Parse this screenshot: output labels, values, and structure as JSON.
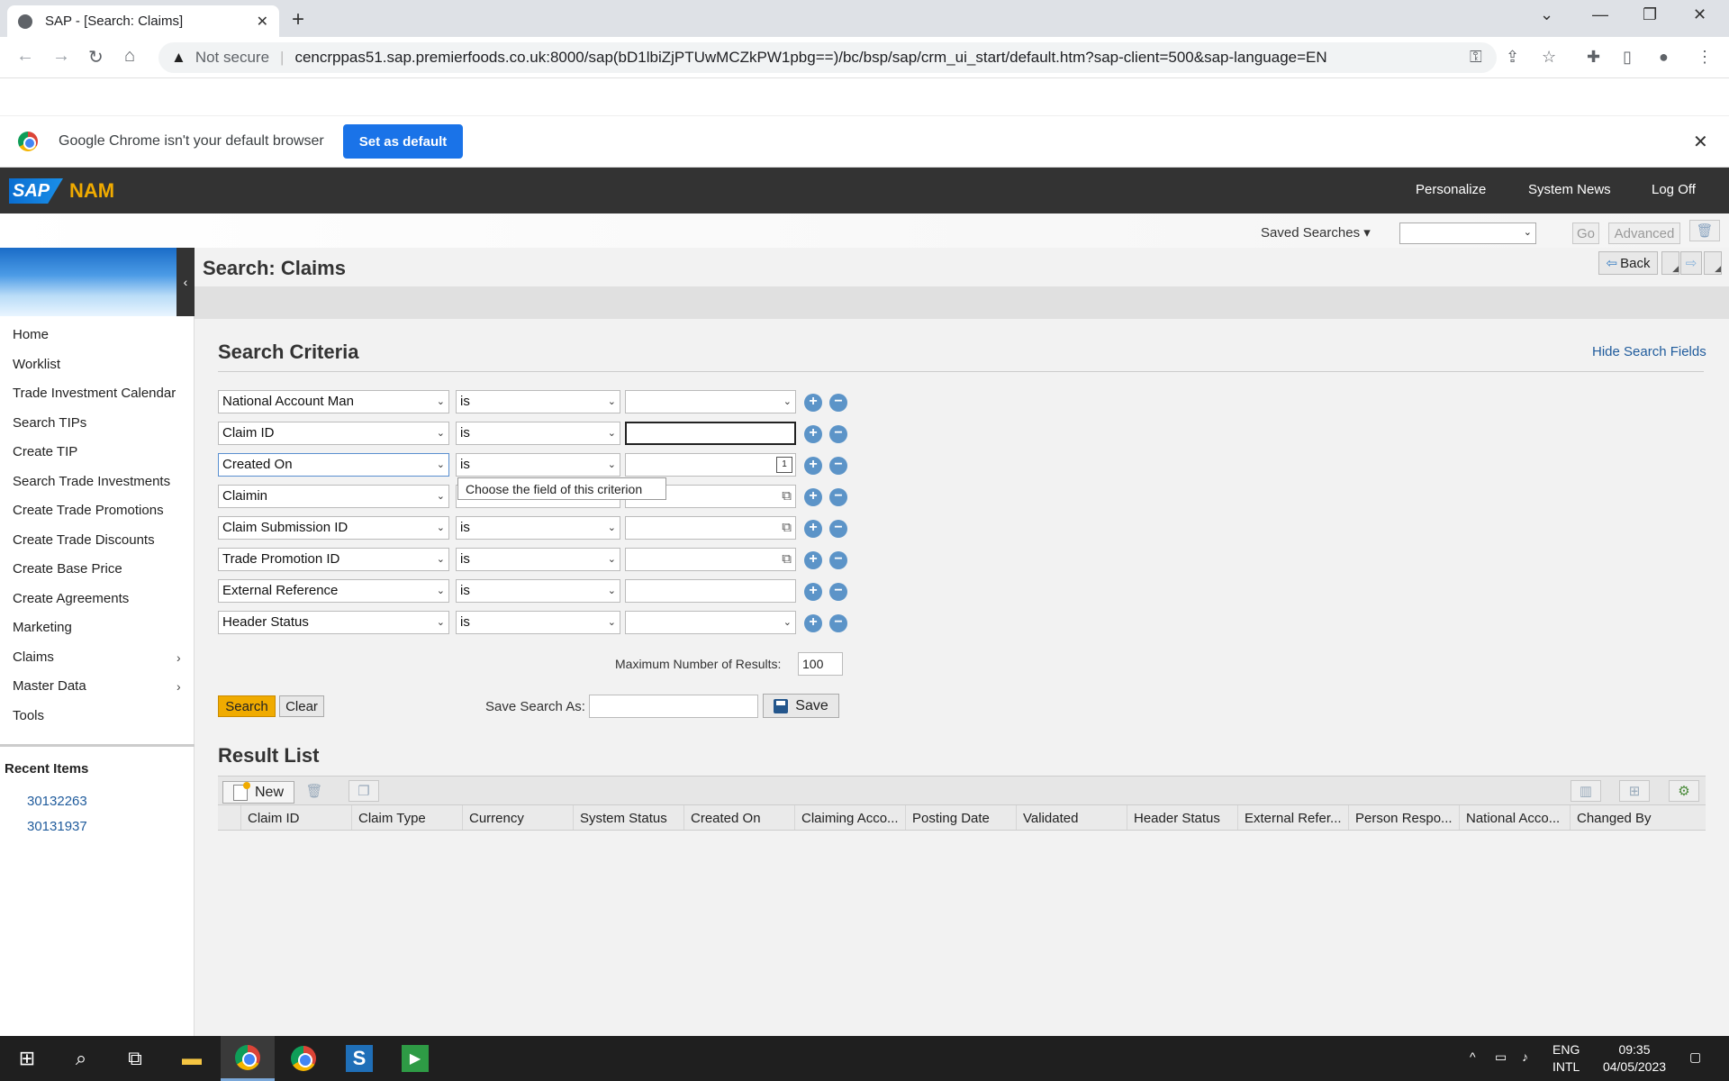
{
  "browser": {
    "tab_title": "SAP - [Search: Claims]",
    "not_secure": "Not secure",
    "url": "cencrppas51.sap.premierfoods.co.uk:8000/sap(bD1lbiZjPTUwMCZkPW1pbg==)/bc/bsp/sap/crm_ui_start/default.htm?sap-client=500&sap-language=EN",
    "infobar_message": "Google Chrome isn't your default browser",
    "set_default_label": "Set as default"
  },
  "sap_header": {
    "logo": "SAP",
    "app_name": "NAM",
    "links": [
      "Personalize",
      "System News",
      "Log Off"
    ]
  },
  "saved_searches": {
    "label": "Saved Searches",
    "selected": "",
    "go_label": "Go",
    "advanced_label": "Advanced"
  },
  "sidebar": {
    "items": [
      "Home",
      "Worklist",
      "Trade Investment Calendar",
      "Search TIPs",
      "Create TIP",
      "Search Trade Investments",
      "Create Trade Promotions",
      "Create Trade Discounts",
      "Create Base Price",
      "Create Agreements",
      "Marketing",
      "Claims",
      "Master Data",
      "Tools"
    ],
    "recent_heading": "Recent Items",
    "recent_items": [
      "30132263",
      "30131937"
    ]
  },
  "page": {
    "title": "Search: Claims",
    "back_label": "Back"
  },
  "search": {
    "title": "Search Criteria",
    "hide_fields_label": "Hide Search Fields",
    "criteria": [
      {
        "field": "National Account Man",
        "operator": "is",
        "value": ""
      },
      {
        "field": "Claim ID",
        "operator": "is",
        "value": ""
      },
      {
        "field": "Created On",
        "operator": "is",
        "value": ""
      },
      {
        "field": "Claimin",
        "operator": "is",
        "value": ""
      },
      {
        "field": "Claim Submission ID",
        "operator": "is",
        "value": ""
      },
      {
        "field": "Trade Promotion ID",
        "operator": "is",
        "value": ""
      },
      {
        "field": "External Reference",
        "operator": "is",
        "value": ""
      },
      {
        "field": "Header Status",
        "operator": "is",
        "value": ""
      }
    ],
    "tooltip": "Choose the field of this criterion",
    "max_results_label": "Maximum Number of Results:",
    "max_results_value": "100",
    "search_label": "Search",
    "clear_label": "Clear",
    "save_as_label": "Save Search As:",
    "save_label": "Save"
  },
  "result_list": {
    "title": "Result List",
    "new_label": "New",
    "columns": [
      "Claim ID",
      "Claim Type",
      "Currency",
      "System Status",
      "Created On",
      "Claiming Acco...",
      "Posting Date",
      "Validated",
      "Header Status",
      "External Refer...",
      "Person Respo...",
      "National Acco...",
      "Changed By"
    ]
  },
  "taskbar": {
    "lang": "ENG",
    "layout": "INTL",
    "time": "09:35",
    "date": "04/05/2023"
  }
}
